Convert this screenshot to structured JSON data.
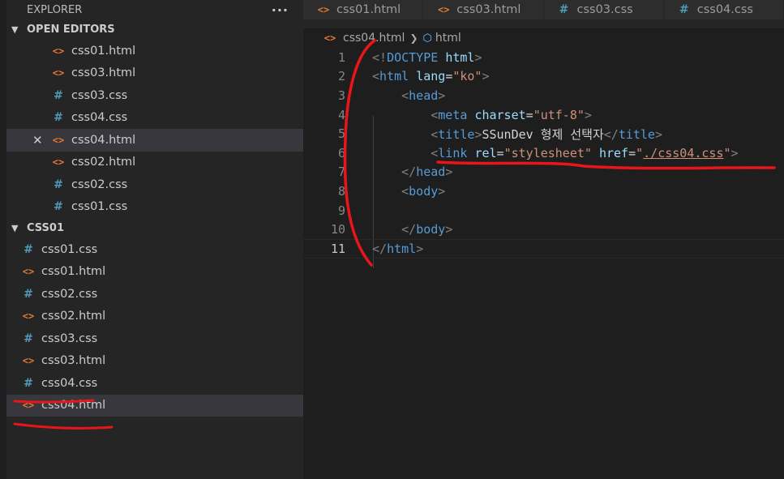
{
  "explorer": {
    "title": "EXPLORER",
    "more": "···",
    "open_editors": {
      "title": "OPEN EDITORS",
      "items": [
        {
          "name": "css01.html",
          "type": "html"
        },
        {
          "name": "css03.html",
          "type": "html"
        },
        {
          "name": "css03.css",
          "type": "css"
        },
        {
          "name": "css04.css",
          "type": "css"
        },
        {
          "name": "css04.html",
          "type": "html"
        },
        {
          "name": "css02.html",
          "type": "html"
        },
        {
          "name": "css02.css",
          "type": "css"
        },
        {
          "name": "css01.css",
          "type": "css"
        }
      ]
    },
    "folder": {
      "title": "CSS01",
      "items": [
        {
          "name": "css01.css",
          "type": "css"
        },
        {
          "name": "css01.html",
          "type": "html"
        },
        {
          "name": "css02.css",
          "type": "css"
        },
        {
          "name": "css02.html",
          "type": "html"
        },
        {
          "name": "css03.css",
          "type": "css"
        },
        {
          "name": "css03.html",
          "type": "html"
        },
        {
          "name": "css04.css",
          "type": "css"
        },
        {
          "name": "css04.html",
          "type": "html"
        }
      ]
    }
  },
  "tabs": [
    {
      "name": "css01.html",
      "type": "html"
    },
    {
      "name": "css03.html",
      "type": "html"
    },
    {
      "name": "css03.css",
      "type": "css"
    },
    {
      "name": "css04.css",
      "type": "css"
    }
  ],
  "breadcrumb": {
    "file": "css04.html",
    "symbol": "html"
  },
  "editor": {
    "line_numbers": [
      "1",
      "2",
      "3",
      "4",
      "5",
      "6",
      "7",
      "8",
      "9",
      "10",
      "11"
    ],
    "active_line": "11",
    "l1": {
      "open": "<!",
      "doctype": "DOCTYPE",
      "html": "html",
      "close": ">"
    },
    "l2": {
      "open": "<",
      "tag": "html",
      "attr": "lang",
      "eq": "=",
      "val": "\"ko\"",
      "close": ">"
    },
    "l3": {
      "open": "<",
      "tag": "head",
      "close": ">"
    },
    "l4": {
      "open": "<",
      "tag": "meta",
      "attr": "charset",
      "eq": "=",
      "val": "\"utf-8\"",
      "close": ">"
    },
    "l5": {
      "open": "<",
      "tag": "title",
      "close": ">",
      "text": "SSunDev 형제 선택자",
      "end_open": "</",
      "end_tag": "title",
      "end_close": ">"
    },
    "l6": {
      "open": "<",
      "tag": "link",
      "attr1": "rel",
      "eq1": "=",
      "val1": "\"stylesheet\"",
      "attr2": "href",
      "eq2": "=",
      "q1": "\"",
      "href": "./css04.css",
      "q2": "\"",
      "close": ">"
    },
    "l7": {
      "open": "</",
      "tag": "head",
      "close": ">"
    },
    "l8": {
      "open": "<",
      "tag": "body",
      "close": ">"
    },
    "l10": {
      "open": "</",
      "tag": "body",
      "close": ">"
    },
    "l11": {
      "open": "</",
      "tag": "html",
      "close": ">"
    }
  },
  "colors": {
    "annotation": "#e8161a",
    "html_icon": "#e37933",
    "css_icon": "#519aba"
  }
}
